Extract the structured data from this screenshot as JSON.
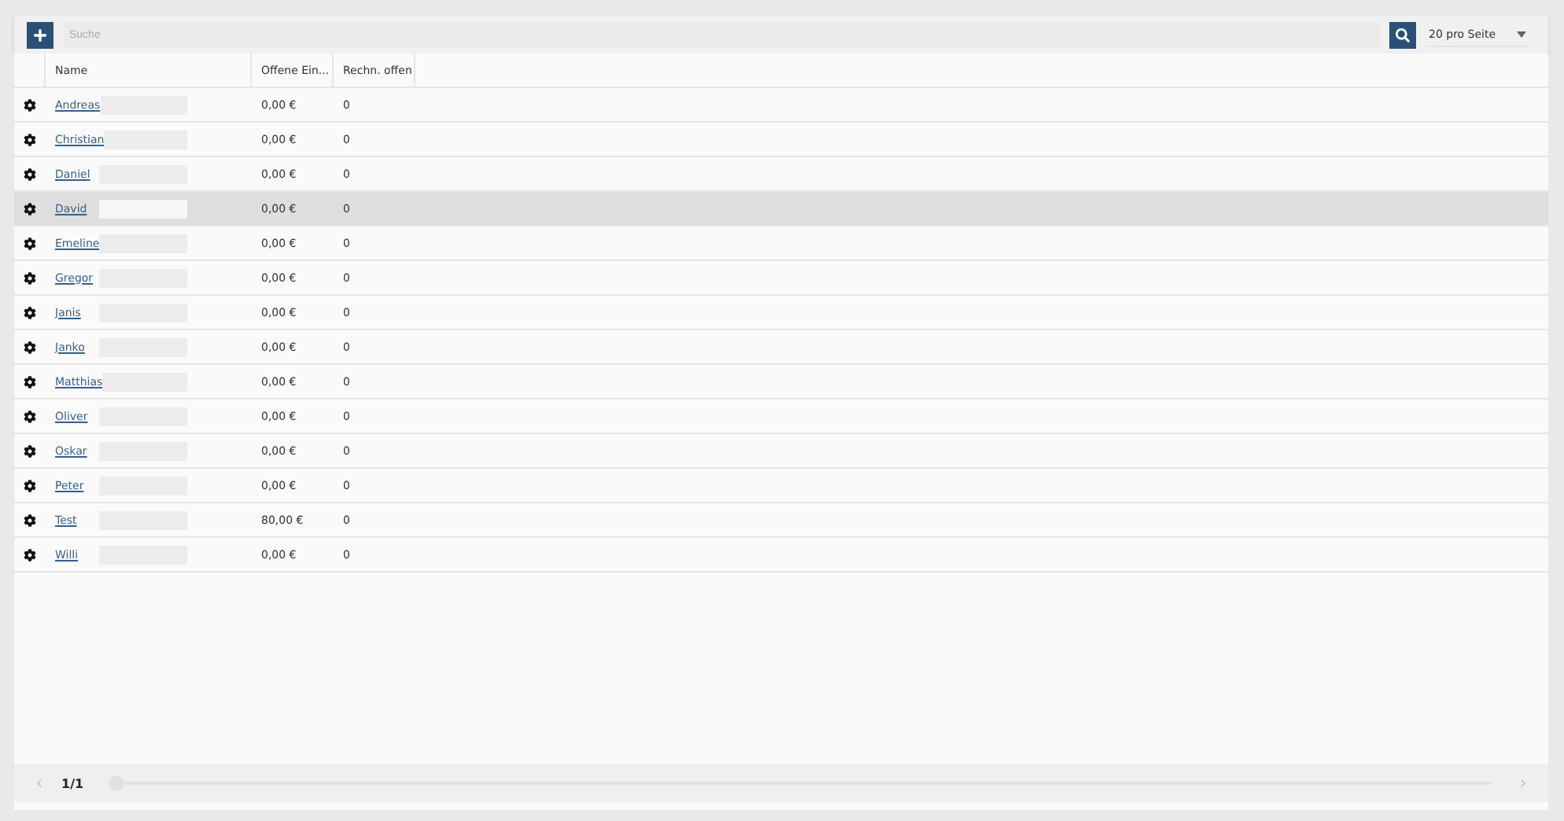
{
  "toolbar": {
    "search": {
      "placeholder": "Suche"
    },
    "page_size": "20 pro Seite"
  },
  "table": {
    "columns": [
      "Name",
      "Offene Ein...",
      "Rechn. offen"
    ],
    "rows": [
      {
        "name": "Andreas",
        "open_amount": "0,00 €",
        "open_invoices": "0",
        "selected": false
      },
      {
        "name": "Christian",
        "open_amount": "0,00 €",
        "open_invoices": "0",
        "selected": false
      },
      {
        "name": "Daniel",
        "open_amount": "0,00 €",
        "open_invoices": "0",
        "selected": false
      },
      {
        "name": "David",
        "open_amount": "0,00 €",
        "open_invoices": "0",
        "selected": true
      },
      {
        "name": "Emeline",
        "open_amount": "0,00 €",
        "open_invoices": "0",
        "selected": false
      },
      {
        "name": "Gregor",
        "open_amount": "0,00 €",
        "open_invoices": "0",
        "selected": false
      },
      {
        "name": "Janis",
        "open_amount": "0,00 €",
        "open_invoices": "0",
        "selected": false
      },
      {
        "name": "Janko",
        "open_amount": "0,00 €",
        "open_invoices": "0",
        "selected": false
      },
      {
        "name": "Matthias",
        "open_amount": "0,00 €",
        "open_invoices": "0",
        "selected": false
      },
      {
        "name": "Oliver",
        "open_amount": "0,00 €",
        "open_invoices": "0",
        "selected": false
      },
      {
        "name": "Oskar",
        "open_amount": "0,00 €",
        "open_invoices": "0",
        "selected": false
      },
      {
        "name": "Peter",
        "open_amount": "0,00 €",
        "open_invoices": "0",
        "selected": false
      },
      {
        "name": "Test",
        "open_amount": "80,00 €",
        "open_invoices": "0",
        "selected": false
      },
      {
        "name": "Willi",
        "open_amount": "0,00 €",
        "open_invoices": "0",
        "selected": false
      }
    ]
  },
  "pager": {
    "page": "1/1",
    "level": 0
  }
}
